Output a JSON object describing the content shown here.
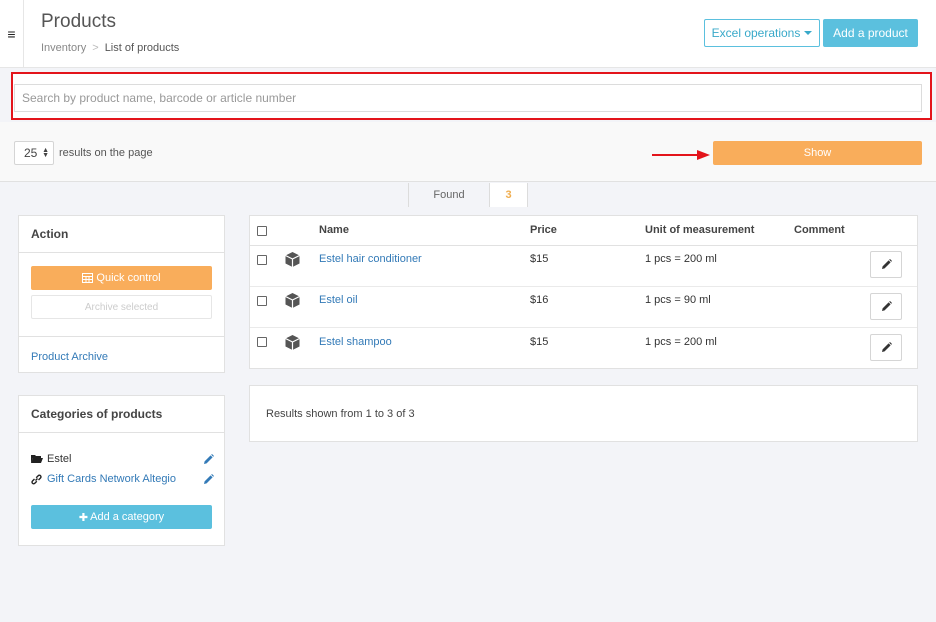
{
  "header": {
    "title": "Products",
    "breadcrumb": {
      "parent": "Inventory",
      "separator": ">",
      "current": "List of products"
    },
    "excel_button": "Excel operations",
    "add_product_button": "Add a product"
  },
  "search": {
    "placeholder": "Search by product name, barcode or article number",
    "value": ""
  },
  "filter": {
    "per_page_value": "25",
    "per_page_label": "results on the page",
    "show_button": "Show"
  },
  "found": {
    "label": "Found",
    "count": "3"
  },
  "action_panel": {
    "title": "Action",
    "quick_control": "Quick control",
    "archive_selected": "Archive selected",
    "product_archive": "Product Archive"
  },
  "categories_panel": {
    "title": "Categories of products",
    "items": [
      {
        "label": "Estel",
        "icon": "folder-open-icon"
      },
      {
        "label": "Gift Cards Network Altegio",
        "icon": "link-icon"
      }
    ],
    "add_button": "Add a category"
  },
  "table": {
    "columns": [
      "Name",
      "Price",
      "Unit of measurement",
      "Comment"
    ],
    "rows": [
      {
        "name": "Estel hair conditioner",
        "price": "$15",
        "unit": "1 pcs = 200 ml",
        "comment": ""
      },
      {
        "name": "Estel oil",
        "price": "$16",
        "unit": "1 pcs = 90 ml",
        "comment": ""
      },
      {
        "name": "Estel shampoo",
        "price": "$15",
        "unit": "1 pcs = 200 ml",
        "comment": ""
      }
    ]
  },
  "results_summary": "Results shown from 1 to 3 of 3",
  "colors": {
    "accent_blue": "#5bc0de",
    "accent_orange": "#f9ad5b",
    "link": "#337ab7",
    "highlight_red": "#e3141b"
  }
}
